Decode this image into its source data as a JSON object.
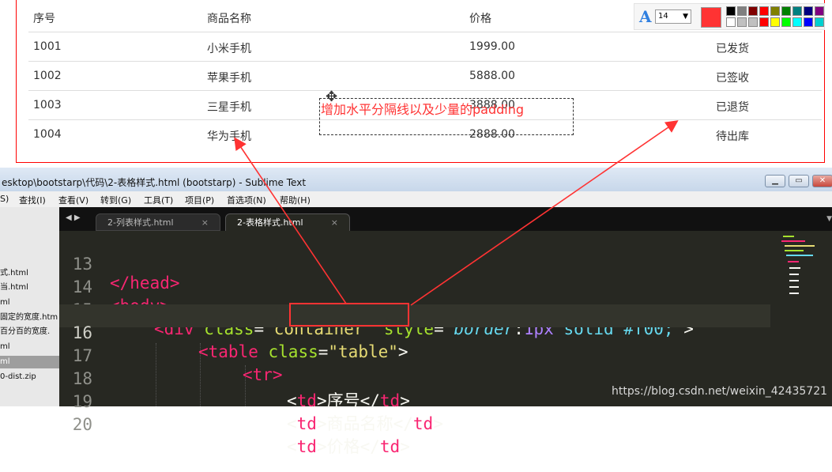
{
  "table": {
    "headers": [
      "序号",
      "商品名称",
      "价格",
      ""
    ],
    "rows": [
      [
        "1001",
        "小米手机",
        "1999.00",
        "已发货"
      ],
      [
        "1002",
        "苹果手机",
        "5888.00",
        "已签收"
      ],
      [
        "1003",
        "三星手机",
        "3888.00",
        "已退货"
      ],
      [
        "1004",
        "华为手机",
        "2888.00",
        "待出库"
      ]
    ]
  },
  "toolbar": {
    "font_icon": "A",
    "font_size": "14",
    "current_color": "#ff3333",
    "palette": [
      "#000000",
      "#808080",
      "#800000",
      "#ff0000",
      "#808000",
      "#008000",
      "#008080",
      "#000080",
      "#800080",
      "#ffffff",
      "#c0c0c0",
      "#c0c0c0",
      "#ff0000",
      "#ffff00",
      "#00ff00",
      "#00ffff",
      "#0000ff",
      "#00d0d0"
    ]
  },
  "annotation": {
    "text": "增加水平分隔线以及少量的padding"
  },
  "sublime": {
    "title": "esktop\\bootstarp\\代码\\2-表格样式.html (bootstarp) - Sublime Text",
    "menu": [
      "S)",
      "查找(I)",
      "查看(V)",
      "转到(G)",
      "工具(T)",
      "项目(P)",
      "首选项(N)",
      "帮助(H)"
    ],
    "sidebar_items": [
      "式.html",
      "当.html",
      "ml",
      "固定的宽度.htm",
      "百分百的宽度.",
      "ml",
      "ml",
      "0-dist.zip"
    ],
    "tabs": [
      {
        "label": "2-列表样式.html",
        "close": "×"
      },
      {
        "label": "2-表格样式.html",
        "close": "×"
      }
    ],
    "line_numbers": [
      "13",
      "14",
      "15",
      "16",
      "17",
      "18",
      "19",
      "20"
    ],
    "code": {
      "l13": "</head>",
      "l14": "<body>",
      "l15_tag": "<div",
      "l15_attr": "class",
      "l15_val": "\"container\"",
      "l15_attr2": "style",
      "l15_prop": "border",
      "l15_num": "1px",
      "l15_rest": "solid #f00;",
      "l16_tag": "<table",
      "l16_attr": "class",
      "l16_val": "\"table\"",
      "l17": "<tr>",
      "l18_text": "序号",
      "l19_text": "商品名称",
      "l20_text": "价格"
    }
  },
  "watermark": "https://blog.csdn.net/weixin_42435721",
  "colors": {
    "annotation_red": "#ff3333",
    "container_border": "#ff0000"
  }
}
